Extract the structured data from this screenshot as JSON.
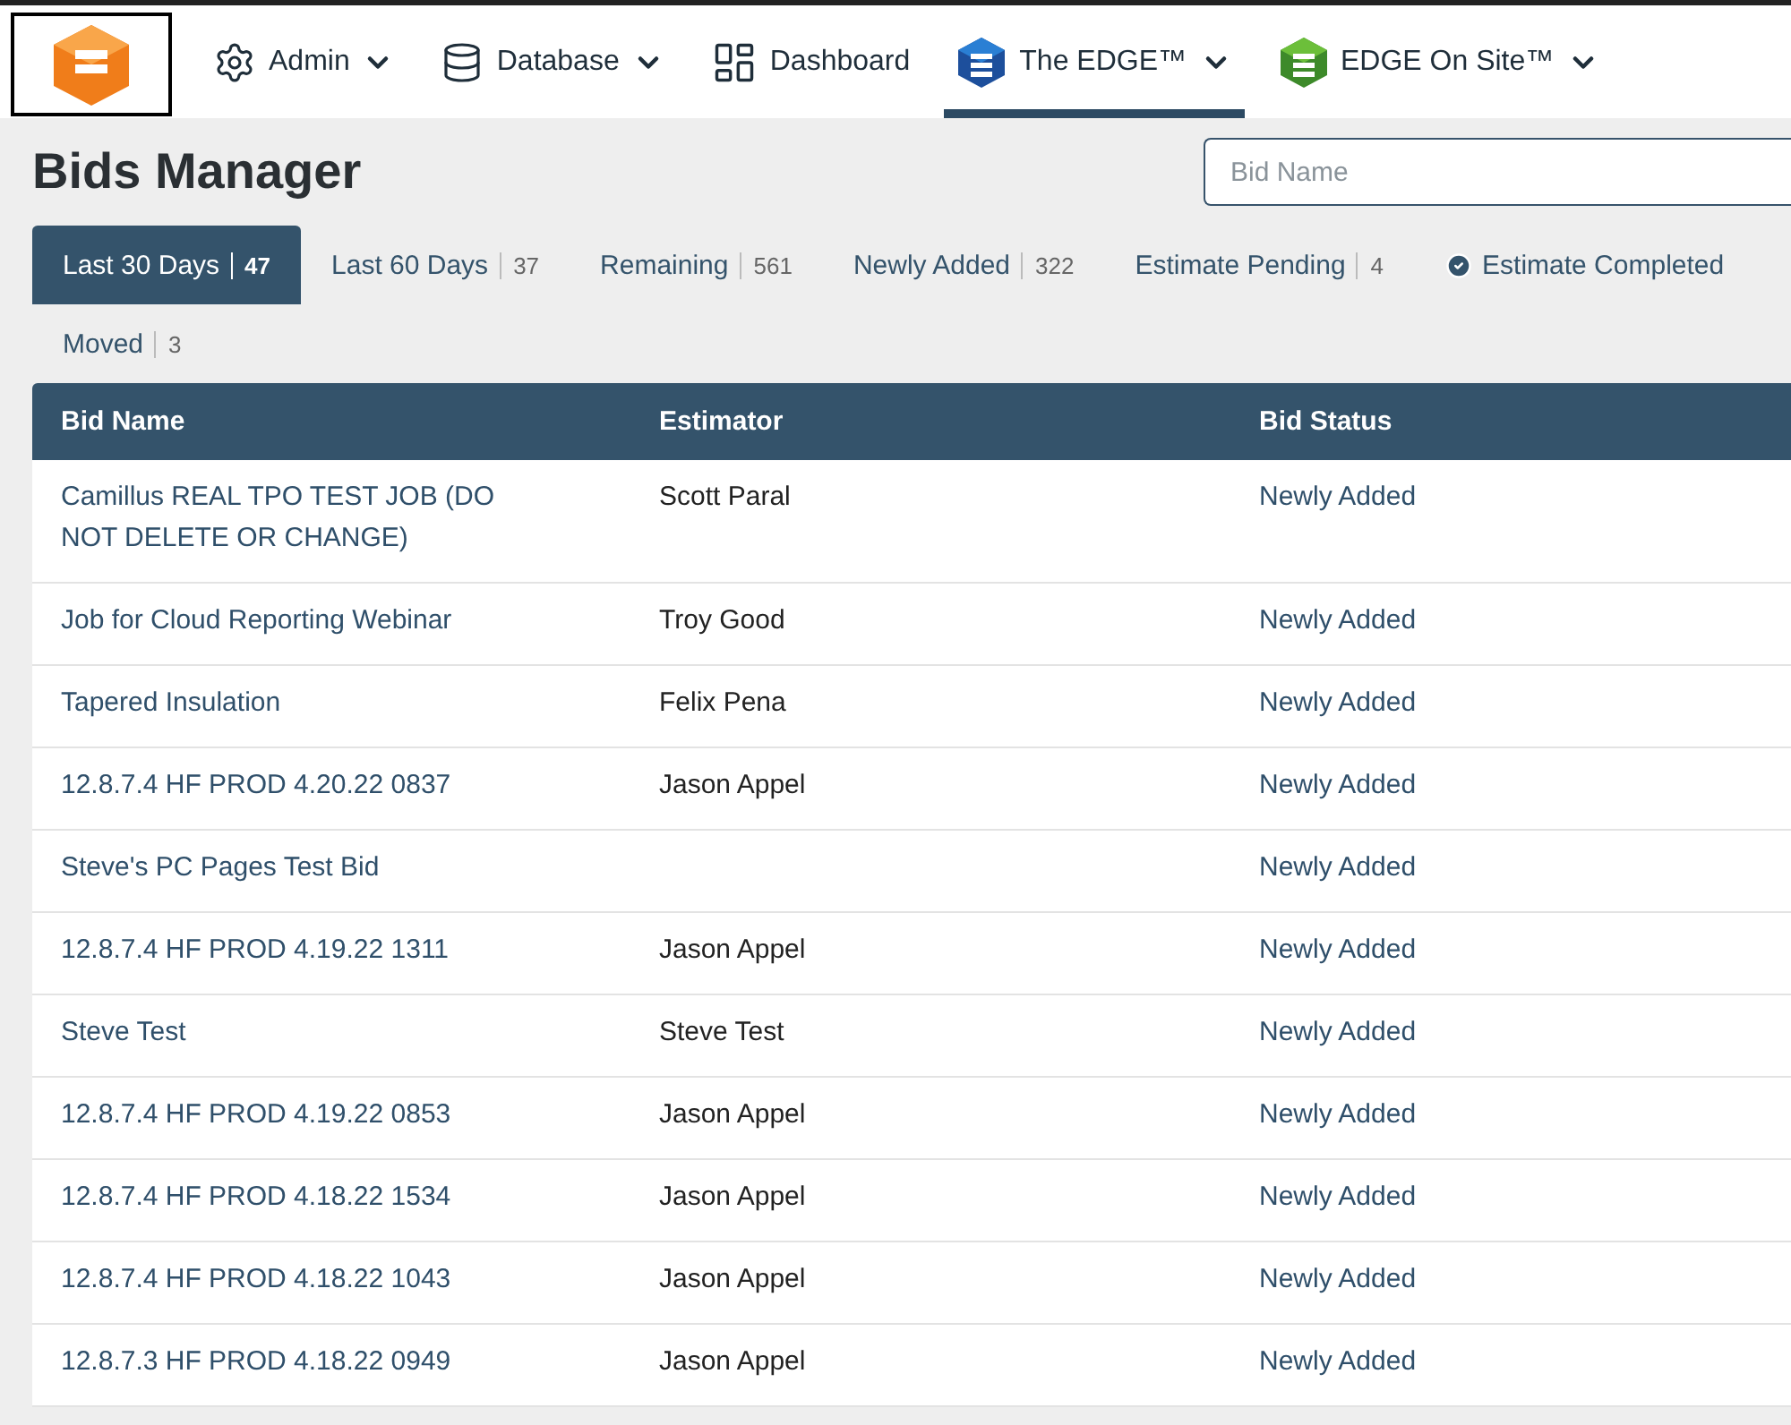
{
  "nav": [
    {
      "label": "Admin",
      "kind": "gear",
      "dropdown": true,
      "selected": false
    },
    {
      "label": "Database",
      "kind": "database",
      "dropdown": true,
      "selected": false
    },
    {
      "label": "Dashboard",
      "kind": "dashboard",
      "dropdown": false,
      "selected": false
    },
    {
      "label": "The EDGE™",
      "kind": "edge-blue",
      "dropdown": true,
      "selected": true
    },
    {
      "label": "EDGE On Site™",
      "kind": "edge-green",
      "dropdown": true,
      "selected": false
    }
  ],
  "title": "Bids Manager",
  "search": {
    "placeholder": "Bid Name"
  },
  "tabs": [
    {
      "label": "Last 30 Days",
      "count": "47",
      "selected": true
    },
    {
      "label": "Last 60 Days",
      "count": "37",
      "selected": false
    },
    {
      "label": "Remaining",
      "count": "561",
      "selected": false
    },
    {
      "label": "Newly Added",
      "count": "322",
      "selected": false
    },
    {
      "label": "Estimate Pending",
      "count": "4",
      "selected": false
    },
    {
      "label": "Estimate Completed",
      "kind": "checked",
      "selected": false
    },
    {
      "label": "Moved",
      "count": "3",
      "selected": false
    }
  ],
  "table": {
    "columns": [
      "Bid Name",
      "Estimator",
      "Bid Status"
    ],
    "rows": [
      [
        "Camillus REAL TPO TEST JOB (DO NOT DELETE OR CHANGE)",
        "Scott Paral",
        "Newly Added"
      ],
      [
        "Job for Cloud Reporting Webinar",
        "Troy Good",
        "Newly Added"
      ],
      [
        "Tapered Insulation",
        "Felix Pena",
        "Newly Added"
      ],
      [
        "12.8.7.4 HF PROD 4.20.22 0837",
        "Jason Appel",
        "Newly Added"
      ],
      [
        "Steve's PC Pages Test Bid",
        "",
        "Newly Added"
      ],
      [
        "12.8.7.4 HF PROD 4.19.22 1311",
        "Jason Appel",
        "Newly Added"
      ],
      [
        "Steve Test",
        "Steve Test",
        "Newly Added"
      ],
      [
        "12.8.7.4 HF PROD 4.19.22 0853",
        "Jason Appel",
        "Newly Added"
      ],
      [
        "12.8.7.4 HF PROD 4.18.22 1534",
        "Jason Appel",
        "Newly Added"
      ],
      [
        "12.8.7.4 HF PROD 4.18.22 1043",
        "Jason Appel",
        "Newly Added"
      ],
      [
        "12.8.7.3 HF PROD 4.18.22 0949",
        "Jason Appel",
        "Newly Added"
      ]
    ]
  }
}
